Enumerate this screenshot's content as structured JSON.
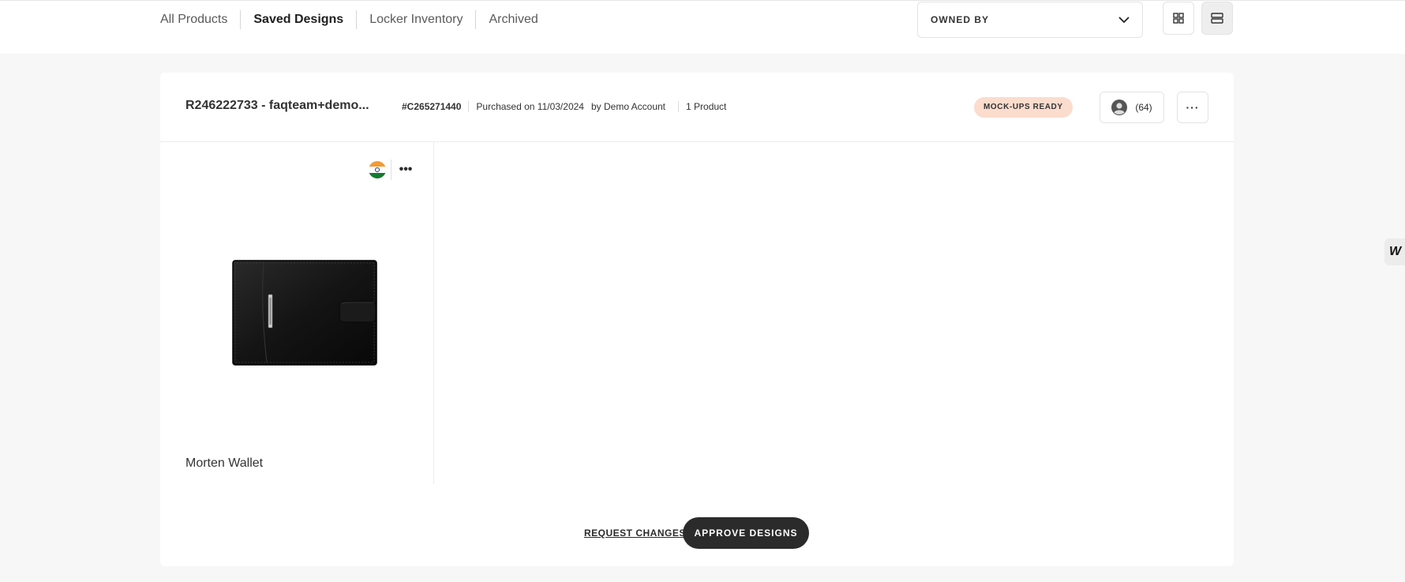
{
  "nav": {
    "tabs": [
      {
        "label": "All Products",
        "active": false
      },
      {
        "label": "Saved Designs",
        "active": true
      },
      {
        "label": "Locker Inventory",
        "active": false
      },
      {
        "label": "Archived",
        "active": false
      }
    ],
    "owned_by_label": "OWNED BY",
    "view_toggle_icons": [
      "grid-view-icon",
      "list-view-icon"
    ],
    "active_view": "list"
  },
  "order": {
    "title": "R246222733 - faqteam+demo...",
    "number": "#C265271440",
    "purchased": "Purchased on 11/03/2024",
    "by": "by Demo Account",
    "product_count": "1 Product",
    "status_badge": "MOCK-UPS READY",
    "users_count": "(64)",
    "more_label": "···"
  },
  "product": {
    "name": "Morten Wallet",
    "flag": "india-flag",
    "more_label": "•••"
  },
  "actions": {
    "request_changes": "REQUEST CHANGES",
    "approve": "APPROVE DESIGNS"
  },
  "side_widget": {
    "label": "W"
  },
  "colors": {
    "page_bg": "#f7f7f7",
    "badge_bg": "#fbdccd",
    "primary_button": "#2b2b2b"
  }
}
